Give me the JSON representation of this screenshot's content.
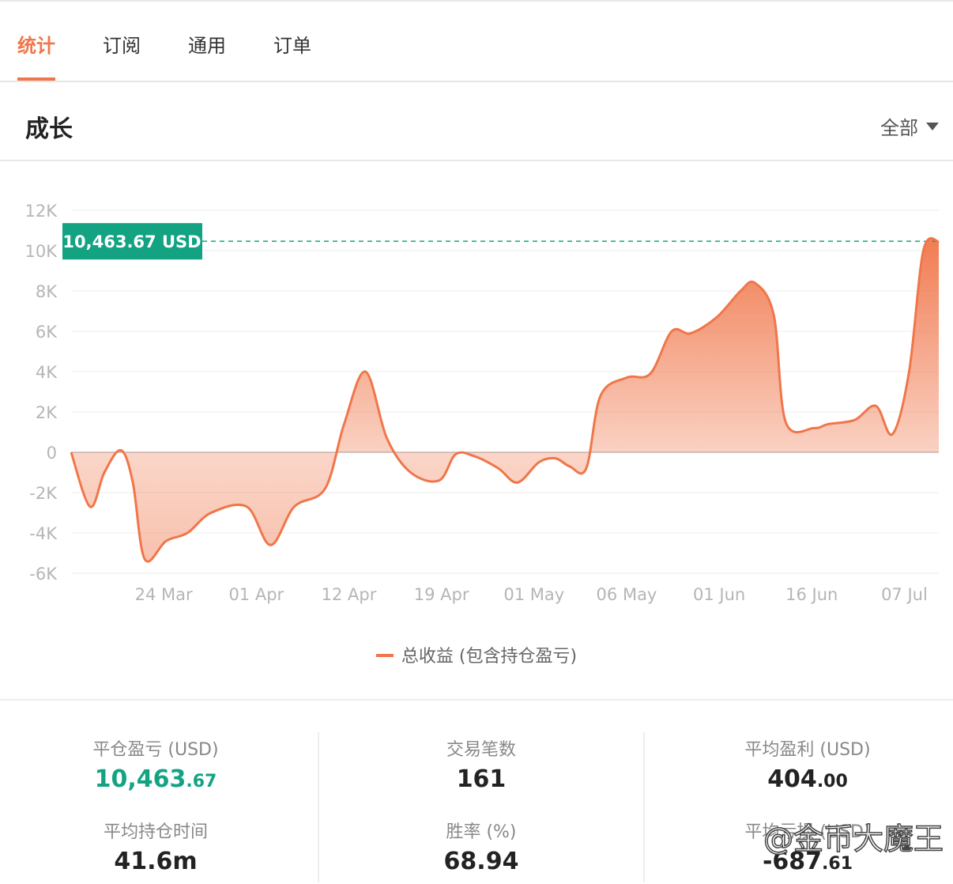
{
  "tabs": [
    {
      "label": "统计",
      "active": true
    },
    {
      "label": "订阅",
      "active": false
    },
    {
      "label": "通用",
      "active": false
    },
    {
      "label": "订单",
      "active": false
    }
  ],
  "section": {
    "title": "成长",
    "filter_label": "全部"
  },
  "chart_data": {
    "type": "area",
    "yticks": [
      "12K",
      "10K",
      "8K",
      "6K",
      "4K",
      "2K",
      "0",
      "-2K",
      "-4K",
      "-6K"
    ],
    "ylim": [
      -6000,
      12000
    ],
    "xlim": [
      0,
      36.55
    ],
    "xticks": [
      {
        "label": "24 Mar",
        "x": 3.9
      },
      {
        "label": "01 Apr",
        "x": 7.8
      },
      {
        "label": "12 Apr",
        "x": 11.7
      },
      {
        "label": "19 Apr",
        "x": 15.6
      },
      {
        "label": "01 May",
        "x": 19.5
      },
      {
        "label": "06 May",
        "x": 23.4
      },
      {
        "label": "01 Jun",
        "x": 27.3
      },
      {
        "label": "16 Jun",
        "x": 31.2
      },
      {
        "label": "07 Jul",
        "x": 35.1
      }
    ],
    "series": [
      {
        "name": "总收益 (包含持仓盈亏)",
        "color": "#f0764a",
        "points": [
          [
            0,
            0
          ],
          [
            0.8,
            -2700
          ],
          [
            1.4,
            -1000
          ],
          [
            2.1,
            100
          ],
          [
            2.6,
            -1500
          ],
          [
            3.1,
            -5300
          ],
          [
            4.0,
            -4400
          ],
          [
            4.9,
            -4000
          ],
          [
            5.9,
            -3000
          ],
          [
            7.4,
            -2700
          ],
          [
            8.4,
            -4600
          ],
          [
            9.4,
            -2700
          ],
          [
            10.7,
            -1800
          ],
          [
            11.5,
            1400
          ],
          [
            12.4,
            4000
          ],
          [
            13.3,
            700
          ],
          [
            14.3,
            -1000
          ],
          [
            15.5,
            -1400
          ],
          [
            16.2,
            -100
          ],
          [
            17.0,
            -200
          ],
          [
            18.0,
            -800
          ],
          [
            18.8,
            -1500
          ],
          [
            19.7,
            -500
          ],
          [
            20.4,
            -300
          ],
          [
            21.0,
            -700
          ],
          [
            21.7,
            -800
          ],
          [
            22.3,
            2800
          ],
          [
            23.4,
            3700
          ],
          [
            24.4,
            3900
          ],
          [
            25.3,
            6000
          ],
          [
            26.1,
            5900
          ],
          [
            27.2,
            6700
          ],
          [
            28.2,
            8000
          ],
          [
            28.8,
            8400
          ],
          [
            29.6,
            6800
          ],
          [
            30.1,
            1500
          ],
          [
            31.3,
            1200
          ],
          [
            31.9,
            1400
          ],
          [
            33.0,
            1600
          ],
          [
            33.9,
            2300
          ],
          [
            34.6,
            900
          ],
          [
            35.3,
            4000
          ],
          [
            35.9,
            10000
          ],
          [
            36.55,
            10463.67
          ]
        ]
      }
    ],
    "marker": {
      "label": "10,463.67 USD",
      "value": 10463.67,
      "color": "#13a383"
    },
    "grid": true,
    "legend": "bottom"
  },
  "stats": {
    "col1": {
      "s1": {
        "label": "平仓盈亏 (USD)",
        "int": "10,463",
        "dec": ".67"
      },
      "s2": {
        "label": "平均持仓时间",
        "value": "41.6m"
      }
    },
    "col2": {
      "s1": {
        "label": "交易笔数",
        "value": "161"
      },
      "s2": {
        "label": "胜率 (%)",
        "value": "68.94"
      }
    },
    "col3": {
      "s1": {
        "label": "平均盈利 (USD)",
        "int": "404",
        "dec": ".00"
      },
      "s2": {
        "label": "平均亏损 (USD)",
        "int": "-687",
        "dec": ".61"
      }
    }
  },
  "watermark": "@金币大魔王"
}
